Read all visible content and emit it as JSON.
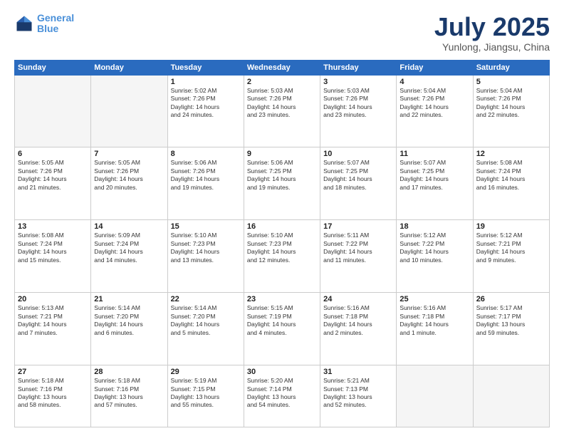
{
  "header": {
    "logo_line1": "General",
    "logo_line2": "Blue",
    "month_title": "July 2025",
    "subtitle": "Yunlong, Jiangsu, China"
  },
  "weekdays": [
    "Sunday",
    "Monday",
    "Tuesday",
    "Wednesday",
    "Thursday",
    "Friday",
    "Saturday"
  ],
  "weeks": [
    [
      {
        "day": "",
        "info": ""
      },
      {
        "day": "",
        "info": ""
      },
      {
        "day": "1",
        "info": "Sunrise: 5:02 AM\nSunset: 7:26 PM\nDaylight: 14 hours\nand 24 minutes."
      },
      {
        "day": "2",
        "info": "Sunrise: 5:03 AM\nSunset: 7:26 PM\nDaylight: 14 hours\nand 23 minutes."
      },
      {
        "day": "3",
        "info": "Sunrise: 5:03 AM\nSunset: 7:26 PM\nDaylight: 14 hours\nand 23 minutes."
      },
      {
        "day": "4",
        "info": "Sunrise: 5:04 AM\nSunset: 7:26 PM\nDaylight: 14 hours\nand 22 minutes."
      },
      {
        "day": "5",
        "info": "Sunrise: 5:04 AM\nSunset: 7:26 PM\nDaylight: 14 hours\nand 22 minutes."
      }
    ],
    [
      {
        "day": "6",
        "info": "Sunrise: 5:05 AM\nSunset: 7:26 PM\nDaylight: 14 hours\nand 21 minutes."
      },
      {
        "day": "7",
        "info": "Sunrise: 5:05 AM\nSunset: 7:26 PM\nDaylight: 14 hours\nand 20 minutes."
      },
      {
        "day": "8",
        "info": "Sunrise: 5:06 AM\nSunset: 7:26 PM\nDaylight: 14 hours\nand 19 minutes."
      },
      {
        "day": "9",
        "info": "Sunrise: 5:06 AM\nSunset: 7:25 PM\nDaylight: 14 hours\nand 19 minutes."
      },
      {
        "day": "10",
        "info": "Sunrise: 5:07 AM\nSunset: 7:25 PM\nDaylight: 14 hours\nand 18 minutes."
      },
      {
        "day": "11",
        "info": "Sunrise: 5:07 AM\nSunset: 7:25 PM\nDaylight: 14 hours\nand 17 minutes."
      },
      {
        "day": "12",
        "info": "Sunrise: 5:08 AM\nSunset: 7:24 PM\nDaylight: 14 hours\nand 16 minutes."
      }
    ],
    [
      {
        "day": "13",
        "info": "Sunrise: 5:08 AM\nSunset: 7:24 PM\nDaylight: 14 hours\nand 15 minutes."
      },
      {
        "day": "14",
        "info": "Sunrise: 5:09 AM\nSunset: 7:24 PM\nDaylight: 14 hours\nand 14 minutes."
      },
      {
        "day": "15",
        "info": "Sunrise: 5:10 AM\nSunset: 7:23 PM\nDaylight: 14 hours\nand 13 minutes."
      },
      {
        "day": "16",
        "info": "Sunrise: 5:10 AM\nSunset: 7:23 PM\nDaylight: 14 hours\nand 12 minutes."
      },
      {
        "day": "17",
        "info": "Sunrise: 5:11 AM\nSunset: 7:22 PM\nDaylight: 14 hours\nand 11 minutes."
      },
      {
        "day": "18",
        "info": "Sunrise: 5:12 AM\nSunset: 7:22 PM\nDaylight: 14 hours\nand 10 minutes."
      },
      {
        "day": "19",
        "info": "Sunrise: 5:12 AM\nSunset: 7:21 PM\nDaylight: 14 hours\nand 9 minutes."
      }
    ],
    [
      {
        "day": "20",
        "info": "Sunrise: 5:13 AM\nSunset: 7:21 PM\nDaylight: 14 hours\nand 7 minutes."
      },
      {
        "day": "21",
        "info": "Sunrise: 5:14 AM\nSunset: 7:20 PM\nDaylight: 14 hours\nand 6 minutes."
      },
      {
        "day": "22",
        "info": "Sunrise: 5:14 AM\nSunset: 7:20 PM\nDaylight: 14 hours\nand 5 minutes."
      },
      {
        "day": "23",
        "info": "Sunrise: 5:15 AM\nSunset: 7:19 PM\nDaylight: 14 hours\nand 4 minutes."
      },
      {
        "day": "24",
        "info": "Sunrise: 5:16 AM\nSunset: 7:18 PM\nDaylight: 14 hours\nand 2 minutes."
      },
      {
        "day": "25",
        "info": "Sunrise: 5:16 AM\nSunset: 7:18 PM\nDaylight: 14 hours\nand 1 minute."
      },
      {
        "day": "26",
        "info": "Sunrise: 5:17 AM\nSunset: 7:17 PM\nDaylight: 13 hours\nand 59 minutes."
      }
    ],
    [
      {
        "day": "27",
        "info": "Sunrise: 5:18 AM\nSunset: 7:16 PM\nDaylight: 13 hours\nand 58 minutes."
      },
      {
        "day": "28",
        "info": "Sunrise: 5:18 AM\nSunset: 7:16 PM\nDaylight: 13 hours\nand 57 minutes."
      },
      {
        "day": "29",
        "info": "Sunrise: 5:19 AM\nSunset: 7:15 PM\nDaylight: 13 hours\nand 55 minutes."
      },
      {
        "day": "30",
        "info": "Sunrise: 5:20 AM\nSunset: 7:14 PM\nDaylight: 13 hours\nand 54 minutes."
      },
      {
        "day": "31",
        "info": "Sunrise: 5:21 AM\nSunset: 7:13 PM\nDaylight: 13 hours\nand 52 minutes."
      },
      {
        "day": "",
        "info": ""
      },
      {
        "day": "",
        "info": ""
      }
    ]
  ]
}
